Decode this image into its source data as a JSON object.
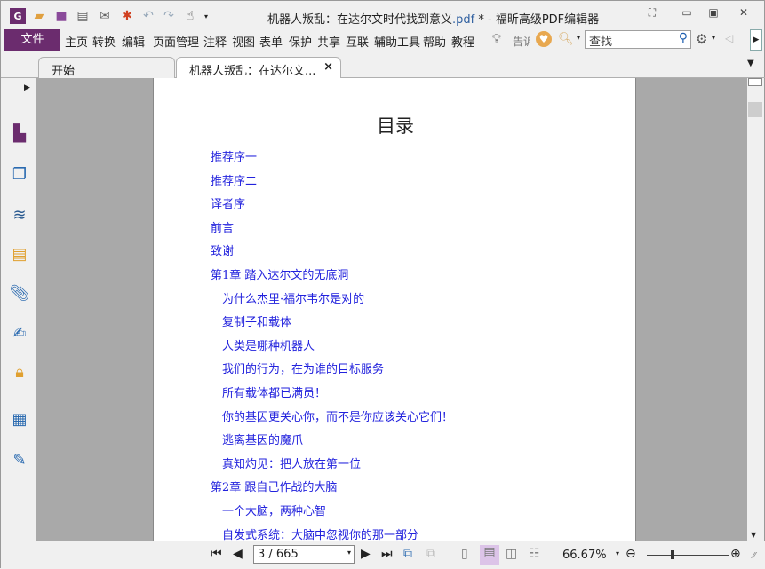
{
  "window": {
    "title_main": "机器人叛乱：在达尔文时代找到意义",
    "title_ext": ".pdf",
    "title_rest": " * - 福昕高级PDF编辑器"
  },
  "menu": {
    "file": "文件",
    "items": [
      "主页",
      "转换",
      "编辑",
      "页面管理",
      "注释",
      "视图",
      "表单",
      "保护",
      "共享",
      "互联",
      "辅助工具",
      "帮助",
      "教程"
    ],
    "tell": "告诉",
    "search_placeholder": "查找"
  },
  "tabs": [
    {
      "label": "开始"
    },
    {
      "label": "机器人叛乱：在达尔文...",
      "close": "×"
    }
  ],
  "document": {
    "heading": "目录",
    "toc": [
      {
        "text": "推荐序一",
        "level": 1
      },
      {
        "text": "推荐序二",
        "level": 1
      },
      {
        "text": "译者序",
        "level": 1
      },
      {
        "text": "前言",
        "level": 1
      },
      {
        "text": "致谢",
        "level": 1
      },
      {
        "text": "第1章 踏入达尔文的无底洞",
        "level": 1
      },
      {
        "text": "为什么杰里·福尔韦尔是对的",
        "level": 2
      },
      {
        "text": "复制子和载体",
        "level": 2
      },
      {
        "text": "人类是哪种机器人",
        "level": 2
      },
      {
        "text": "我们的行为，在为谁的目标服务",
        "level": 2
      },
      {
        "text": "所有载体都已满员！",
        "level": 2
      },
      {
        "text": "你的基因更关心你，而不是你应该关心它们！",
        "level": 2
      },
      {
        "text": "逃离基因的魔爪",
        "level": 2
      },
      {
        "text": "真知灼见：把人放在第一位",
        "level": 2
      },
      {
        "text": "第2章 跟自己作战的大脑",
        "level": 1
      },
      {
        "text": "一个大脑，两种心智",
        "level": 2
      },
      {
        "text": "自发式系统：大脑中忽视你的那一部分",
        "level": 2
      }
    ]
  },
  "status": {
    "page": "3 / 665",
    "zoom": "66.67%"
  },
  "colors": {
    "accent": "#6b2c6e",
    "link": "#2222dd"
  }
}
